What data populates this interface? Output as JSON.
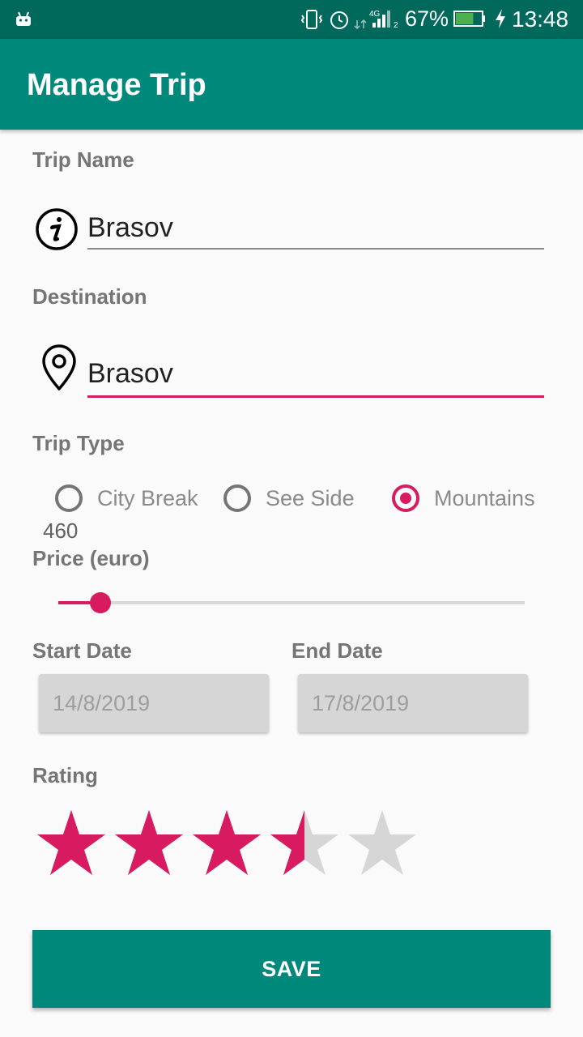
{
  "status_bar": {
    "battery_percent": "67%",
    "time": "13:48",
    "network": "4G",
    "sim_slot": "2",
    "battery_level": 0.67,
    "icons": [
      "android-icon",
      "vibrate-icon",
      "alarm-icon",
      "data-arrows-icon",
      "signal-icon",
      "battery-icon",
      "charging-icon"
    ]
  },
  "app_bar": {
    "title": "Manage Trip"
  },
  "form": {
    "trip_name": {
      "label": "Trip Name",
      "value": "Brasov",
      "icon": "info-icon"
    },
    "destination": {
      "label": "Destination",
      "value": "Brasov",
      "icon": "location-pin-icon"
    },
    "trip_type": {
      "label": "Trip Type",
      "options": [
        "City Break",
        "See Side",
        "Mountains"
      ],
      "selected": "Mountains"
    },
    "price": {
      "label": "Price (euro)",
      "value": "460",
      "fraction": 0.09
    },
    "start_date": {
      "label": "Start Date",
      "value": "14/8/2019"
    },
    "end_date": {
      "label": "End Date",
      "value": "17/8/2019"
    },
    "rating": {
      "label": "Rating",
      "value": 3.5,
      "max": 5
    },
    "save_label": "SAVE"
  },
  "colors": {
    "status_bar": "#00695c",
    "app_bar": "#00897b",
    "accent": "#d81b60",
    "label": "#757575",
    "star_empty": "#d6d6d6",
    "date_bg": "#d6d6d6"
  }
}
